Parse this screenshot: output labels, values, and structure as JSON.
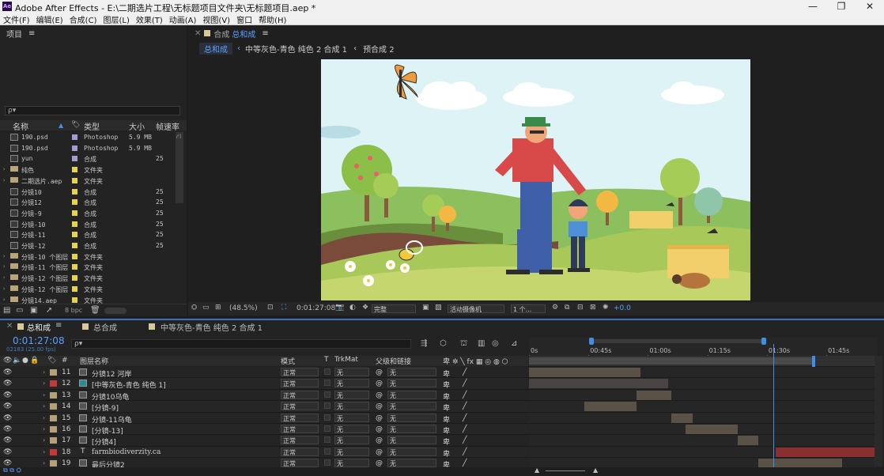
{
  "window": {
    "title": "Adobe After Effects - E:\\二期选片工程\\无标题项目文件夹\\无标题项目.aep *",
    "logo": "Ae"
  },
  "menu": [
    "文件(F)",
    "编辑(E)",
    "合成(C)",
    "图层(L)",
    "效果(T)",
    "动画(A)",
    "视图(V)",
    "窗口",
    "帮助(H)"
  ],
  "project": {
    "tab": "项目",
    "search_placeholder": "ρ▾",
    "columns": {
      "name": "名称",
      "type": "类型",
      "size": "大小",
      "fps": "帧速率"
    },
    "items": [
      {
        "name": "190.psd",
        "type": "Photoshop",
        "size": "5.9 MB",
        "fps": "",
        "kind": "file",
        "color": "#a49bd0"
      },
      {
        "name": "190.psd",
        "type": "Photoshop",
        "size": "5.9 MB",
        "fps": "",
        "kind": "file",
        "color": "#a49bd0"
      },
      {
        "name": "yun",
        "type": "合成",
        "size": "",
        "fps": "25",
        "kind": "comp",
        "color": "#a49bd0"
      },
      {
        "name": "纯色",
        "type": "文件夹",
        "size": "",
        "fps": "",
        "kind": "folder",
        "color": "#e5d44a"
      },
      {
        "name": "二期选片.aep",
        "type": "文件夹",
        "size": "",
        "fps": "",
        "kind": "folder",
        "color": "#e5d44a"
      },
      {
        "name": "分镜10",
        "type": "合成",
        "size": "",
        "fps": "25",
        "kind": "comp",
        "color": "#e5d44a"
      },
      {
        "name": "分镜12",
        "type": "合成",
        "size": "",
        "fps": "25",
        "kind": "comp",
        "color": "#e5d44a"
      },
      {
        "name": "分镜-9",
        "type": "合成",
        "size": "",
        "fps": "25",
        "kind": "comp",
        "color": "#e5d44a"
      },
      {
        "name": "分镜-10",
        "type": "合成",
        "size": "",
        "fps": "25",
        "kind": "comp",
        "color": "#e5d44a"
      },
      {
        "name": "分镜-11",
        "type": "合成",
        "size": "",
        "fps": "25",
        "kind": "comp",
        "color": "#e5d44a"
      },
      {
        "name": "分镜-12",
        "type": "合成",
        "size": "",
        "fps": "25",
        "kind": "comp",
        "color": "#e5d44a"
      },
      {
        "name": "分镜-10 个图层",
        "type": "文件夹",
        "size": "",
        "fps": "",
        "kind": "folder",
        "color": "#e5d44a"
      },
      {
        "name": "分镜-11 个图层",
        "type": "文件夹",
        "size": "",
        "fps": "",
        "kind": "folder",
        "color": "#e5d44a"
      },
      {
        "name": "分镜-12 个图层",
        "type": "文件夹",
        "size": "",
        "fps": "",
        "kind": "folder",
        "color": "#e5d44a"
      },
      {
        "name": "分镜-12 个图层",
        "type": "文件夹",
        "size": "",
        "fps": "",
        "kind": "folder",
        "color": "#e5d44a"
      },
      {
        "name": "分镜14.aep",
        "type": "文件夹",
        "size": "",
        "fps": "",
        "kind": "folder",
        "color": "#e5d44a"
      }
    ],
    "bpc": "8 bpc"
  },
  "composition": {
    "tab_prefix": "合成",
    "tab_name": "总和成",
    "breadcrumbs": [
      "总和成",
      "中等灰色-青色 纯色 2 合成 1",
      "预合成 2"
    ],
    "zoom": "(48.5%)",
    "timecode": "0:01:27:08",
    "quality": "完整",
    "camera": "活动摄像机",
    "views": "1 个...",
    "exposure": "+0.0"
  },
  "timeline": {
    "tabs": [
      "总和成",
      "总合成",
      "中等灰色-青色 纯色 2 合成 1"
    ],
    "current_time": "0:01:27:08",
    "frame_info": "02183 (25.00 fps)",
    "columns": {
      "num": "#",
      "name": "图层名称",
      "mode": "模式",
      "t": "T",
      "trkmat": "TrkMat",
      "parent": "父级和链接"
    },
    "ruler": [
      "0s",
      "00:45s",
      "01:00s",
      "01:15s",
      "01:30s",
      "01:45s"
    ],
    "playhead": 1.3,
    "layers": [
      {
        "num": "11",
        "name": "分镜12 河岸",
        "mode": "正常",
        "trkmat": "无",
        "parent": "无",
        "color": "#b5a07a",
        "type": "comp",
        "bar_start": 0,
        "bar_end": 0.32
      },
      {
        "num": "12",
        "name": "[中等灰色-青色 纯色 1]",
        "mode": "正常",
        "trkmat": "无",
        "parent": "无",
        "color": "#c0393b",
        "type": "solid",
        "bar_start": 0,
        "bar_end": 0.4
      },
      {
        "num": "13",
        "name": "分镜10乌龟",
        "mode": "正常",
        "trkmat": "无",
        "parent": "无",
        "color": "#b5a07a",
        "type": "comp",
        "bar_start": 0.31,
        "bar_end": 0.41
      },
      {
        "num": "14",
        "name": "[分镜-9]",
        "mode": "正常",
        "trkmat": "无",
        "parent": "无",
        "color": "#b5a07a",
        "type": "comp",
        "bar_start": 0.16,
        "bar_end": 0.31
      },
      {
        "num": "15",
        "name": "分镜-11乌龟",
        "mode": "正常",
        "trkmat": "无",
        "parent": "无",
        "color": "#b5a07a",
        "type": "comp",
        "bar_start": 0.41,
        "bar_end": 0.47
      },
      {
        "num": "16",
        "name": "[分镜-13]",
        "mode": "正常",
        "trkmat": "无",
        "parent": "无",
        "color": "#b5a07a",
        "type": "comp",
        "bar_start": 0.45,
        "bar_end": 0.6
      },
      {
        "num": "17",
        "name": "[分镜4]",
        "mode": "正常",
        "trkmat": "无",
        "parent": "无",
        "color": "#b5a07a",
        "type": "comp",
        "bar_start": 0.6,
        "bar_end": 0.66
      },
      {
        "num": "18",
        "name": "farmbiodiverzity.ca",
        "mode": "正常",
        "trkmat": "无",
        "parent": "无",
        "color": "#c0393b",
        "type": "text",
        "bar_start": 0.71,
        "bar_end": 1.0
      },
      {
        "num": "19",
        "name": "最后分镜2",
        "mode": "正常",
        "trkmat": "无",
        "parent": "无",
        "color": "#b5a07a",
        "type": "comp",
        "bar_start": 0.66,
        "bar_end": 0.9
      }
    ]
  }
}
